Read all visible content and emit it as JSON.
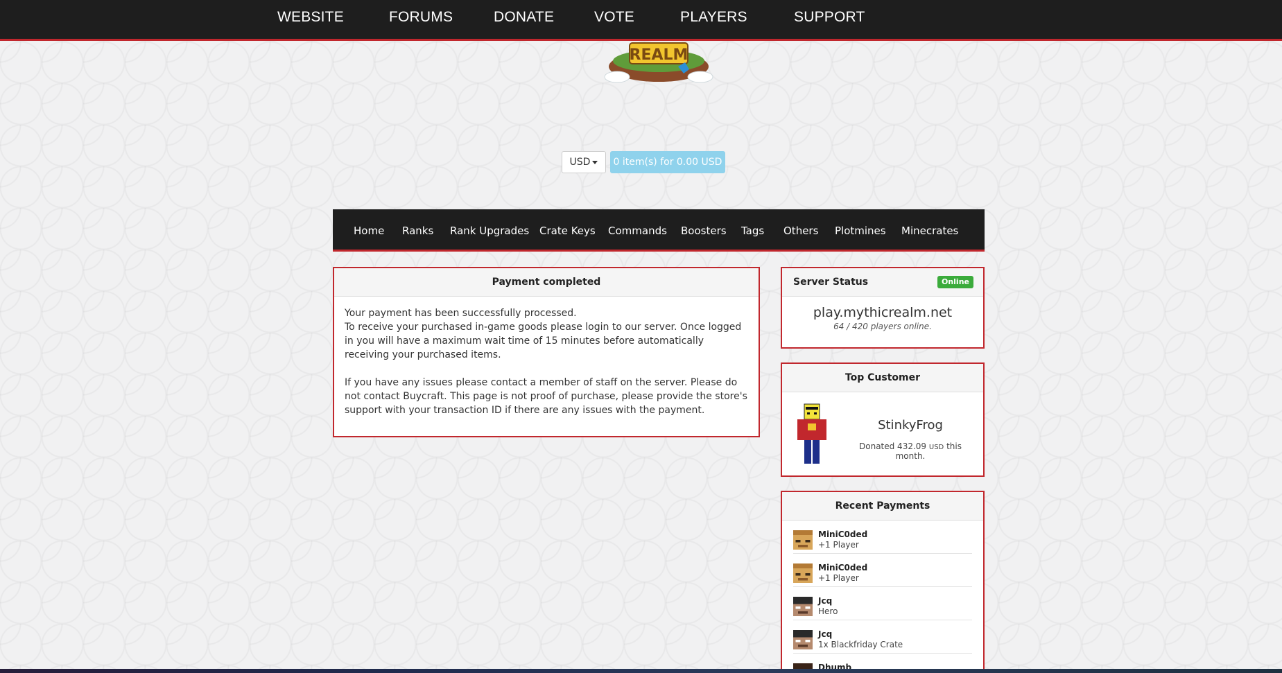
{
  "topnav": [
    "WEBSITE",
    "FORUMS",
    "DONATE",
    "VOTE",
    "PLAYERS",
    "SUPPORT"
  ],
  "logo": {
    "text": "REALM"
  },
  "currency": {
    "selected": "USD"
  },
  "cart": {
    "label": "0 item(s) for 0.00 USD"
  },
  "storenav": [
    "Home",
    "Ranks",
    "Rank Upgrades",
    "Crate Keys",
    "Commands",
    "Boosters",
    "Tags",
    "Others",
    "Plotmines",
    "Minecrates"
  ],
  "payment": {
    "title": "Payment completed",
    "p1_line1": "Your payment has been successfully processed.",
    "p1_line2": "To receive your purchased in-game goods please login to our server. Once logged in you will have a maximum wait time of 15 minutes before automatically receiving your purchased items.",
    "p2": "If you have any issues please contact a member of staff on the server. Please do not contact Buycraft. This page is not proof of purchase, please provide the store's support with your transaction ID if there are any issues with the payment."
  },
  "server_status": {
    "title": "Server Status",
    "badge": "Online",
    "host": "play.mythicrealm.net",
    "players": "64 / 420 players online."
  },
  "top_customer": {
    "title": "Top Customer",
    "name": "StinkyFrog",
    "donated_prefix": "Donated 432.09",
    "currency": "USD",
    "donated_suffix": "this month."
  },
  "recent_payments": {
    "title": "Recent Payments",
    "items": [
      {
        "name": "MiniC0ded",
        "item": "+1 Player"
      },
      {
        "name": "MiniC0ded",
        "item": "+1 Player"
      },
      {
        "name": "Jcq",
        "item": "Hero"
      },
      {
        "name": "Jcq",
        "item": "1x Blackfriday Crate"
      },
      {
        "name": "Dhumb",
        "item": ""
      }
    ]
  },
  "colors": {
    "accent": "#c1272d",
    "nav_bg": "#1e1e1e",
    "online": "#3bab3b",
    "cart": "#8fd2ec"
  }
}
